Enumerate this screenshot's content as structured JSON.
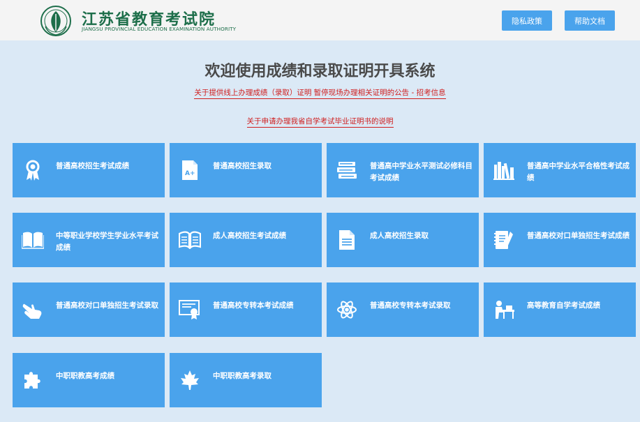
{
  "header": {
    "logo_cn": "江苏省教育考试院",
    "logo_en": "JIANGSU PROVINCIAL EDUCATION EXAMINATION AUTHORITY",
    "privacy_label": "隐私政策",
    "help_label": "帮助文档"
  },
  "main": {
    "title": "欢迎使用成绩和录取证明开具系统",
    "notice_1": "关于提供线上办理成绩（录取）证明 暂停现场办理相关证明的公告 - 招考信息",
    "notice_2": "关于申请办理我省自学考试毕业证明书的说明"
  },
  "tiles": [
    {
      "label": "普通高校招生考试成绩",
      "icon": "award-ribbon-icon"
    },
    {
      "label": "普通高校招生录取",
      "icon": "grade-document-icon"
    },
    {
      "label": "普通高中学业水平测试必修科目考试成绩",
      "icon": "stacked-books-icon"
    },
    {
      "label": "普通高中学业水平合格性考试成绩",
      "icon": "bookshelf-icon"
    },
    {
      "label": "中等职业学校学生学业水平考试成绩",
      "icon": "open-book-icon"
    },
    {
      "label": "成人高校招生考试成绩",
      "icon": "reading-book-icon"
    },
    {
      "label": "成人高校招生录取",
      "icon": "document-icon"
    },
    {
      "label": "普通高校对口单独招生考试成绩",
      "icon": "notebook-pen-icon"
    },
    {
      "label": "普通高校对口单独招生考试录取",
      "icon": "hand-pointer-icon"
    },
    {
      "label": "普通高校专转本考试成绩",
      "icon": "certificate-icon"
    },
    {
      "label": "普通高校专转本考试录取",
      "icon": "atom-icon"
    },
    {
      "label": "高等教育自学考试成绩",
      "icon": "student-desk-icon"
    },
    {
      "label": "中职职教高考成绩",
      "icon": "puzzle-icon"
    },
    {
      "label": "中职职教高考录取",
      "icon": "maple-leaf-icon"
    }
  ],
  "colors": {
    "accent": "#4aa3ec",
    "background": "#dbe9f6",
    "header_bg": "#f4f4f4",
    "logo_green": "#1d6e4a",
    "notice_red": "#d01e1e"
  }
}
